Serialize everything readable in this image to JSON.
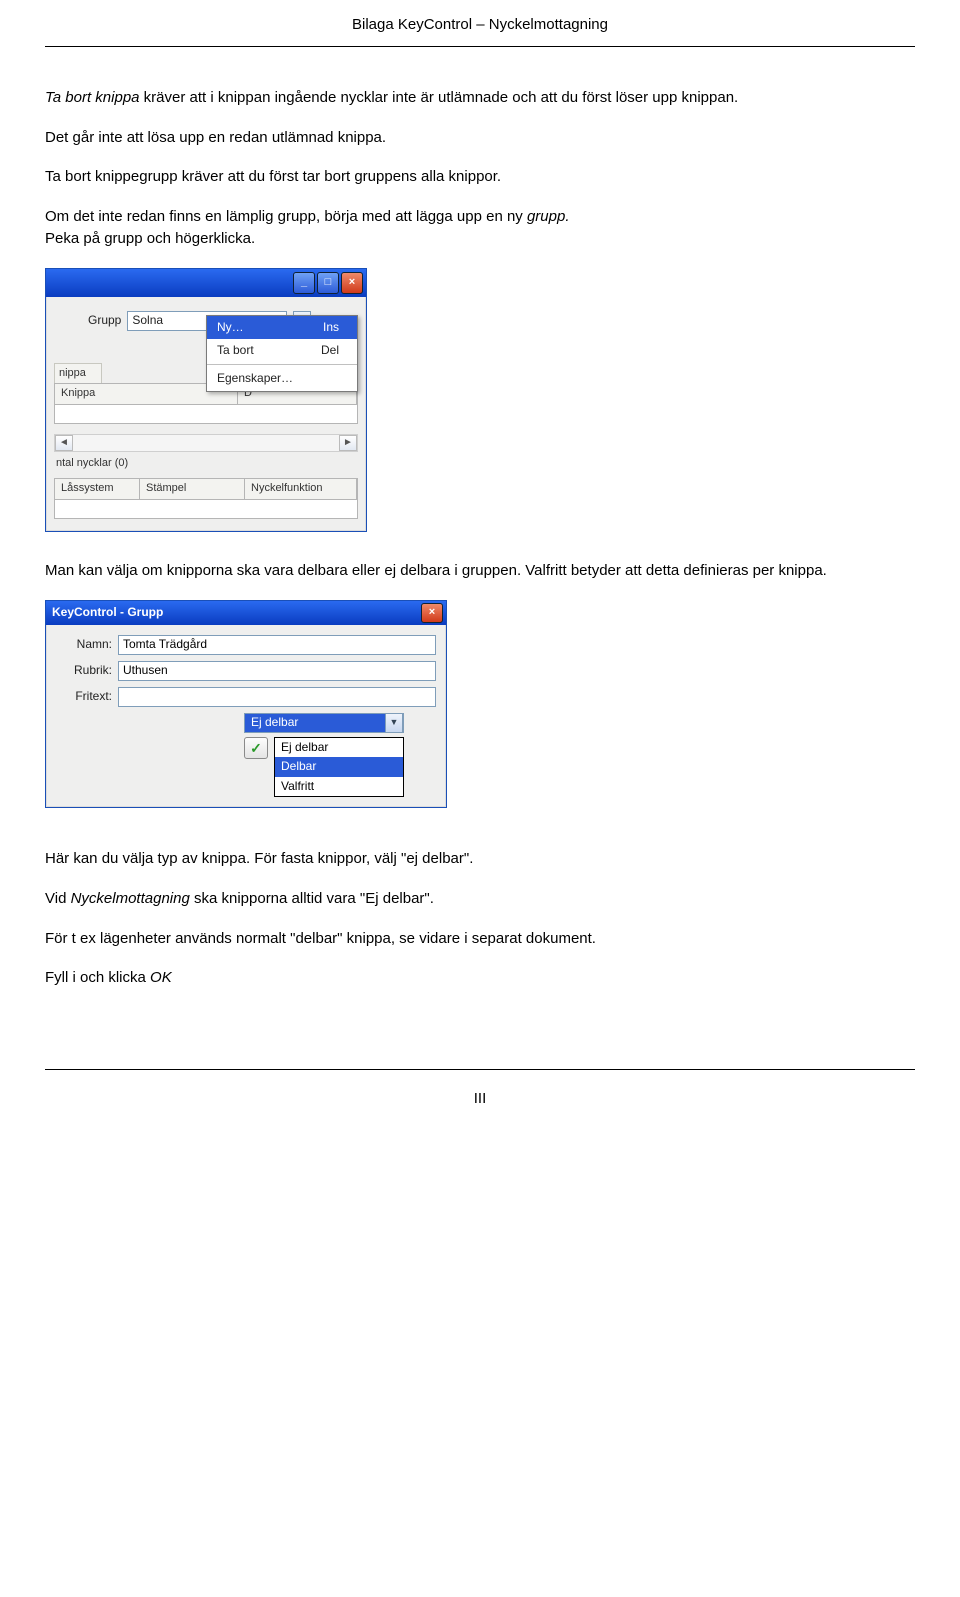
{
  "doc": {
    "header": "Bilaga KeyControl – Nyckelmottagning",
    "page_number": "III"
  },
  "text": {
    "p1a": "Ta bort knippa",
    "p1b": " kräver att i knippan ingående nycklar inte är utlämnade och att du först löser upp knippan.",
    "p2": "Det går inte att lösa upp en redan utlämnad knippa.",
    "p3": "Ta bort knippegrupp kräver att du först tar bort gruppens alla knippor.",
    "p4a": "Om det inte redan finns en lämplig grupp, börja med att lägga upp en ny ",
    "p4b": "grupp.",
    "p5": "Peka på grupp och högerklicka.",
    "p6": "Man kan välja om knipporna ska vara delbara eller ej delbara i gruppen. Valfritt betyder att detta definieras per knippa.",
    "p7": "Här kan du välja typ av knippa. För fasta knippor, välj \"ej delbar\".",
    "p8a": "Vid ",
    "p8b": "Nyckelmottagning",
    "p8c": " ska knipporna alltid vara \"Ej delbar\".",
    "p9": "För t ex lägenheter används normalt \"delbar\" knippa, se vidare i separat dokument.",
    "p10a": "Fyll i och klicka ",
    "p10b": "OK"
  },
  "shot1": {
    "grupp_label": "Grupp",
    "grupp_value": "Solna",
    "menu": {
      "ny": "Ny…",
      "ny_key": "Ins",
      "tabort": "Ta bort",
      "tabort_key": "Del",
      "egensk": "Egenskaper…"
    },
    "tab_nippa": "nippa",
    "hdr_knippa": "Knippa",
    "hdr_d": "D",
    "status": "ntal nycklar (0)",
    "hdr_lassystem": "Låssystem",
    "hdr_stampel": "Stämpel",
    "hdr_nyckelfunktion": "Nyckelfunktion",
    "win_min": "_",
    "win_max": "□",
    "win_close": "×"
  },
  "shot2": {
    "title": "KeyControl - Grupp",
    "close": "×",
    "namn_label": "Namn:",
    "namn_value": "Tomta Trädgård",
    "rubrik_label": "Rubrik:",
    "rubrik_value": "Uthusen",
    "fritext_label": "Fritext:",
    "fritext_value": "",
    "combo_value": "Ej delbar",
    "opt1": "Ej delbar",
    "opt2": "Delbar",
    "opt3": "Valfritt",
    "ok_glyph": "✓"
  }
}
